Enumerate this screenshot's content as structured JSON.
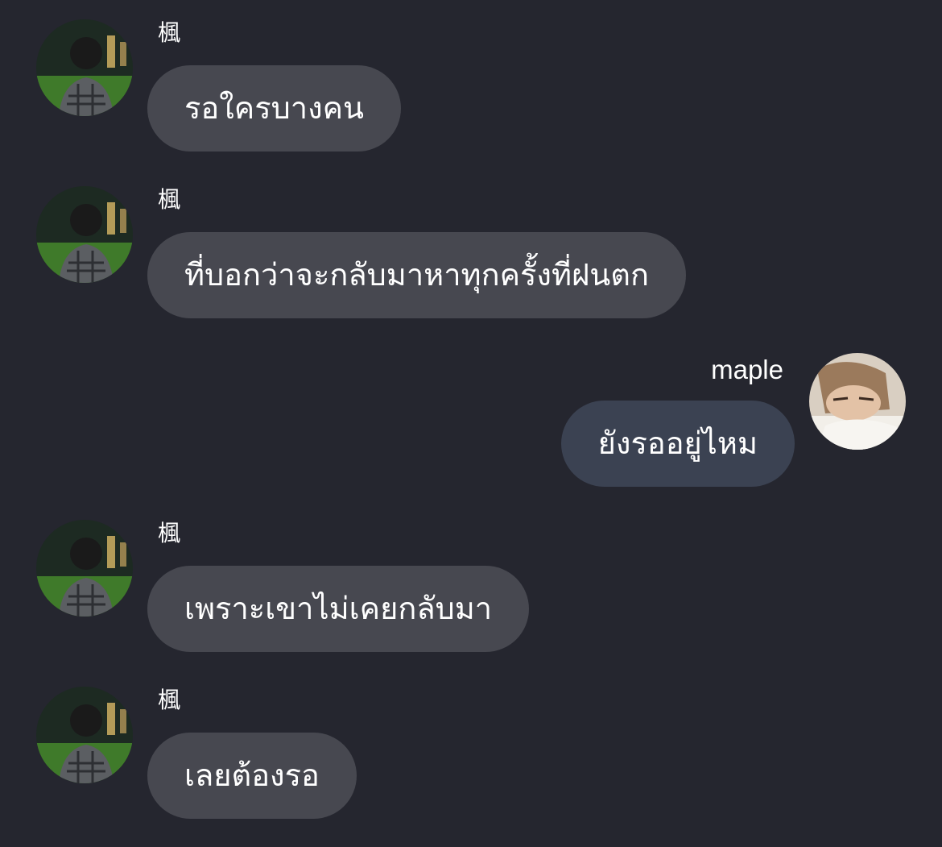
{
  "messages": [
    {
      "side": "left",
      "sender": "楓",
      "text": "รอใครบางคน",
      "avatar": "boy-avatar"
    },
    {
      "side": "left",
      "sender": "楓",
      "text": "ที่บอกว่าจะกลับมาหาทุกครั้งที่ฝนตก",
      "avatar": "boy-avatar"
    },
    {
      "side": "right",
      "sender": "maple",
      "text": "ยังรออยู่ไหม",
      "avatar": "girl-avatar"
    },
    {
      "side": "left",
      "sender": "楓",
      "text": "เพราะเขาไม่เคยกลับมา",
      "avatar": "boy-avatar"
    },
    {
      "side": "left",
      "sender": "楓",
      "text": "เลยต้องรอ",
      "avatar": "boy-avatar"
    }
  ],
  "colors": {
    "background": "#25262f",
    "incoming_bubble": "#474850",
    "outgoing_bubble": "#3b4252",
    "text": "#ffffff"
  }
}
